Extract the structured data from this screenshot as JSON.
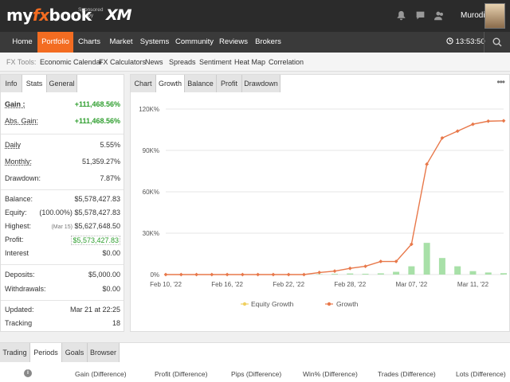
{
  "header": {
    "logo_my": "my",
    "logo_fx": "fx",
    "logo_book": "book",
    "sponsor_line1": "Sponsored",
    "sponsor_line2": "by",
    "sponsor_brand": "XM",
    "username": "Murodil"
  },
  "nav": {
    "items": [
      "Home",
      "Portfolio",
      "Charts",
      "Market",
      "Systems",
      "Community",
      "Reviews",
      "Brokers"
    ],
    "active": "Portfolio",
    "clock": "13:53:50"
  },
  "tools": {
    "label": "FX Tools:",
    "items": [
      "Economic Calendar",
      "FX Calculators",
      "News",
      "Spreads",
      "Sentiment",
      "Heat Map",
      "Correlation"
    ]
  },
  "stats": {
    "tabs": [
      "Info",
      "Stats",
      "General"
    ],
    "active_tab": "Stats",
    "gain_label": "Gain :",
    "gain_value": "+111,468.56%",
    "abs_gain_label": "Abs. Gain:",
    "abs_gain_value": "+111,468.56%",
    "daily_label": "Daily",
    "daily_value": "5.55%",
    "monthly_label": "Monthly:",
    "monthly_value": "51,359.27%",
    "drawdown_label": "Drawdown:",
    "drawdown_value": "7.87%",
    "balance_label": "Balance:",
    "balance_value": "$5,578,427.83",
    "equity_label": "Equity:",
    "equity_pct": "(100.00%)",
    "equity_value": "$5,578,427.83",
    "highest_label": "Highest:",
    "highest_date": "(Mar 15)",
    "highest_value": "$5,627,648.50",
    "profit_label": "Profit:",
    "profit_value": "$5,573,427.83",
    "interest_label": "Interest",
    "interest_value": "$0.00",
    "deposits_label": "Deposits:",
    "deposits_value": "$5,000.00",
    "withdrawals_label": "Withdrawals:",
    "withdrawals_value": "$0.00",
    "updated_label": "Updated:",
    "updated_value": "Mar 21 at 22:25",
    "tracking_label": "Tracking",
    "tracking_value": "18"
  },
  "chart_tabs": {
    "items": [
      "Chart",
      "Growth",
      "Balance",
      "Profit",
      "Drawdown"
    ],
    "active": "Growth",
    "more": "•••"
  },
  "chart_data": {
    "type": "line",
    "y_ticks": [
      "0%",
      "30K%",
      "60K%",
      "90K%",
      "120K%"
    ],
    "ylim": [
      0,
      120000
    ],
    "x_ticks": [
      "Feb 10, '22",
      "Feb 16, '22",
      "Feb 22, '22",
      "Feb 28, '22",
      "Mar 07, '22",
      "Mar 11, '22"
    ],
    "x_tick_index": [
      0,
      4,
      8,
      12,
      16,
      20
    ],
    "legend": [
      "Equity Growth",
      "Growth"
    ],
    "legend_position": "bottom",
    "series": [
      {
        "name": "Growth",
        "color": "#e8784a",
        "values": [
          0,
          0,
          0,
          0,
          0,
          0,
          0,
          0,
          0,
          0,
          1500,
          2500,
          4500,
          6000,
          9500,
          9500,
          22000,
          80000,
          99000,
          104000,
          109000,
          111200,
          111468
        ]
      }
    ],
    "bars": {
      "color": "#a8e0a8",
      "values": [
        0,
        0,
        0,
        0,
        0,
        0,
        0,
        0,
        0,
        0,
        300,
        500,
        800,
        600,
        900,
        2000,
        6000,
        23000,
        12000,
        6000,
        2500,
        1500,
        1000
      ]
    }
  },
  "bottom": {
    "tabs": [
      "Trading",
      "Periods",
      "Goals",
      "Browser"
    ],
    "active_tab": "Periods",
    "columns": [
      "Gain (Difference)",
      "Profit (Difference)",
      "Pips (Difference)",
      "Win% (Difference)",
      "Trades (Difference)",
      "Lots (Difference)"
    ]
  }
}
